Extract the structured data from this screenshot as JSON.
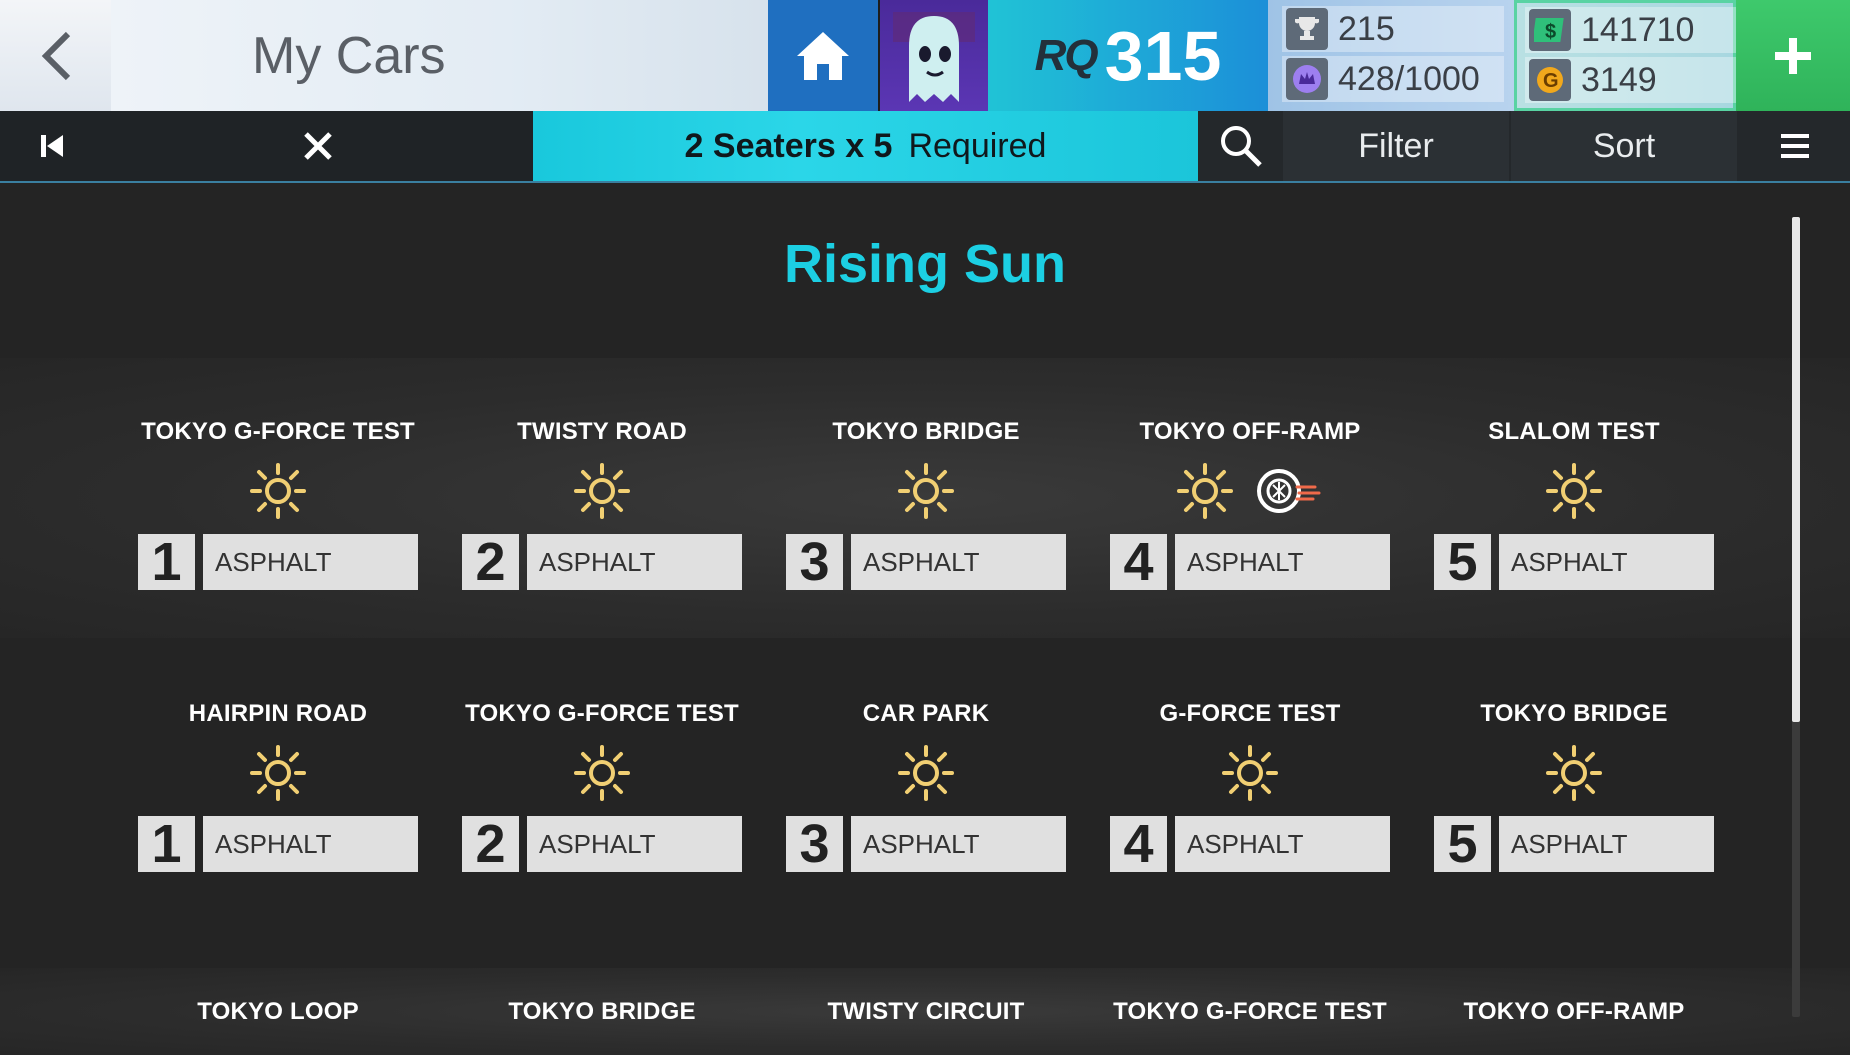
{
  "header": {
    "title": "My Cars",
    "rq_label": "RQ",
    "rq_value": "315",
    "trophies": "215",
    "crowns": "428/1000",
    "cash": "141710",
    "gold": "3149"
  },
  "toolbar": {
    "required_count": "2 Seaters x 5",
    "required_label": "Required",
    "filter": "Filter",
    "sort": "Sort"
  },
  "event": {
    "title": "Rising Sun",
    "rows": [
      [
        {
          "name": "TOKYO G-FORCE TEST",
          "num": "1",
          "surface": "ASPHALT"
        },
        {
          "name": "TWISTY ROAD",
          "num": "2",
          "surface": "ASPHALT"
        },
        {
          "name": "TOKYO BRIDGE",
          "num": "3",
          "surface": "ASPHALT"
        },
        {
          "name": "TOKYO OFF-RAMP",
          "num": "4",
          "surface": "ASPHALT"
        },
        {
          "name": "SLALOM TEST",
          "num": "5",
          "surface": "ASPHALT"
        }
      ],
      [
        {
          "name": "HAIRPIN ROAD",
          "num": "1",
          "surface": "ASPHALT"
        },
        {
          "name": "TOKYO G-FORCE TEST",
          "num": "2",
          "surface": "ASPHALT"
        },
        {
          "name": "CAR PARK",
          "num": "3",
          "surface": "ASPHALT"
        },
        {
          "name": "G-FORCE TEST",
          "num": "4",
          "surface": "ASPHALT"
        },
        {
          "name": "TOKYO BRIDGE",
          "num": "5",
          "surface": "ASPHALT"
        }
      ],
      [
        {
          "name": "TOKYO LOOP"
        },
        {
          "name": "TOKYO BRIDGE"
        },
        {
          "name": "TWISTY CIRCUIT"
        },
        {
          "name": "TOKYO G-FORCE TEST"
        },
        {
          "name": "TOKYO OFF-RAMP"
        }
      ]
    ]
  },
  "icons": {
    "weather": "sun-icon",
    "tyre": "tyre-icon"
  },
  "colors": {
    "accent": "#1ccfe3",
    "rq_bg": "#20c3d6",
    "home_bg": "#1f6fc0",
    "plus_bg": "#3ec96c"
  }
}
